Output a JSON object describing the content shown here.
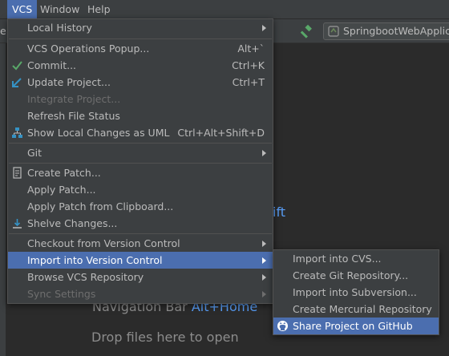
{
  "menubar": {
    "vcs": "VCS",
    "window": "Window",
    "help": "Help"
  },
  "toolbar": {
    "edge_text": "e",
    "run_config_label": "SpringbootWebApplic"
  },
  "editor_hints": {
    "partial": "ift",
    "nav_label": "Navigation Bar",
    "nav_key": "Alt+Home",
    "drop": "Drop files here to open"
  },
  "vcs_menu": {
    "local_history": "Local History",
    "ops_popup": "VCS Operations Popup...",
    "ops_popup_sc": "Alt+`",
    "commit": "Commit...",
    "commit_sc": "Ctrl+K",
    "update": "Update Project...",
    "update_sc": "Ctrl+T",
    "integrate": "Integrate Project...",
    "refresh": "Refresh File Status",
    "show_changes": "Show Local Changes as UML",
    "show_changes_sc": "Ctrl+Alt+Shift+D",
    "git": "Git",
    "create_patch": "Create Patch...",
    "apply_patch": "Apply Patch...",
    "apply_clip": "Apply Patch from Clipboard...",
    "shelve": "Shelve Changes...",
    "checkout": "Checkout from Version Control",
    "import": "Import into Version Control",
    "browse": "Browse VCS Repository",
    "sync": "Sync Settings"
  },
  "import_submenu": {
    "cvs": "Import into CVS...",
    "git_repo": "Create Git Repository...",
    "svn": "Import into Subversion...",
    "hg": "Create Mercurial Repository",
    "github": "Share Project on GitHub"
  },
  "colors": {
    "selection": "#4b6eaf",
    "menu_bg": "#3c3f41",
    "editor_bg": "#2b2b2b",
    "accent_key": "#589df6"
  }
}
